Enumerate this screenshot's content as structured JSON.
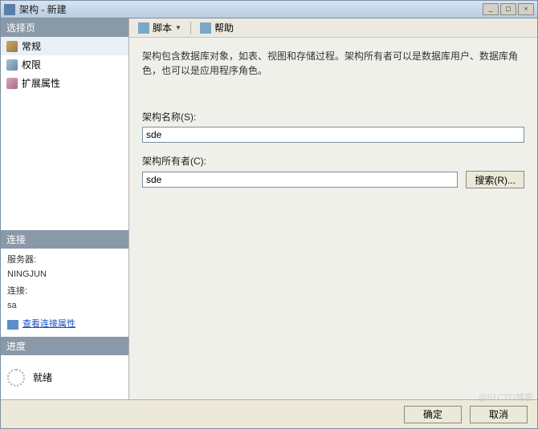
{
  "window": {
    "title": "架构 - 新建"
  },
  "sidebar": {
    "select_page_header": "选择页",
    "nav": [
      {
        "label": "常规",
        "icon": "general",
        "selected": true
      },
      {
        "label": "权限",
        "icon": "perm",
        "selected": false
      },
      {
        "label": "扩展属性",
        "icon": "ext",
        "selected": false
      }
    ],
    "connection_header": "连接",
    "connection": {
      "server_label": "服务器:",
      "server_value": "NINGJUN",
      "conn_label": "连接:",
      "conn_value": "sa",
      "view_props_link": "查看连接属性"
    },
    "progress_header": "进度",
    "progress_status": "就绪"
  },
  "toolbar": {
    "script_label": "脚本",
    "help_label": "帮助"
  },
  "content": {
    "description": "架构包含数据库对象，如表、视图和存储过程。架构所有者可以是数据库用户、数据库角色，也可以是应用程序角色。",
    "schema_name_label": "架构名称(S):",
    "schema_name_value": "sde",
    "schema_owner_label": "架构所有者(C):",
    "schema_owner_value": "sde",
    "search_button": "搜索(R)..."
  },
  "footer": {
    "ok": "确定",
    "cancel": "取消"
  },
  "watermark": "@51CTO博客"
}
